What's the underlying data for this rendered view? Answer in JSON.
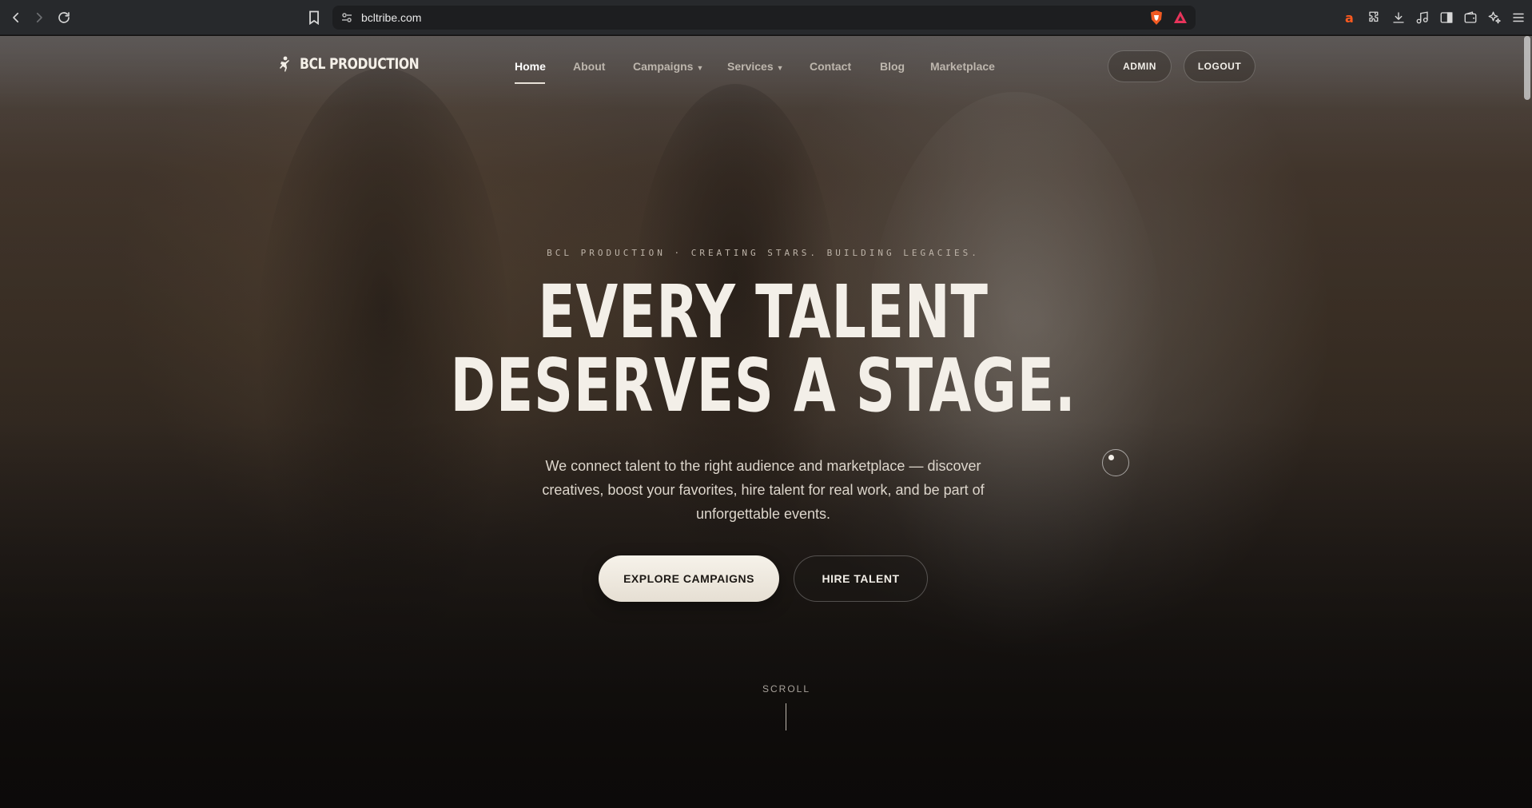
{
  "browser": {
    "url": "bcltribe.com",
    "icons": {
      "back": "arrow-left-icon",
      "forward": "arrow-right-icon",
      "reload": "reload-icon",
      "bookmark": "bookmark-icon",
      "site_info": "site-settings-icon",
      "shield": "brave-shield-icon",
      "rewards": "brave-rewards-icon"
    },
    "extensions": [
      "aliexpress-icon",
      "puzzle-icon",
      "download-icon",
      "music-icon",
      "sidebar-icon",
      "wallet-icon",
      "leo-ai-icon",
      "menu-icon"
    ]
  },
  "site": {
    "logo_text": "BCL PRODUCTION",
    "nav": [
      {
        "label": "Home",
        "active": true
      },
      {
        "label": "About"
      },
      {
        "label": "Campaigns",
        "dropdown": true
      },
      {
        "label": "Services",
        "dropdown": true
      },
      {
        "label": "Contact"
      },
      {
        "label": "Blog"
      },
      {
        "label": "Marketplace"
      }
    ],
    "admin_label": "ADMIN",
    "logout_label": "LOGOUT"
  },
  "hero": {
    "tagline": "BCL PRODUCTION · CREATING STARS. BUILDING LEGACIES.",
    "headline_line1": "EVERY TALENT",
    "headline_line2": "DESERVES A STAGE.",
    "description": "We connect talent to the right audience and marketplace — discover creatives, boost your favorites, hire talent for real work, and be part of unforgettable events.",
    "cta_primary": "EXPLORE CAMPAIGNS",
    "cta_secondary": "HIRE TALENT",
    "scroll_label": "SCROLL"
  },
  "colors": {
    "accent_cream": "#f3efe8",
    "chrome_bg": "#27292c"
  }
}
